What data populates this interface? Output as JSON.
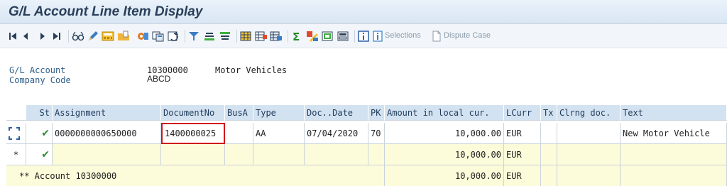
{
  "window": {
    "title": "G/L Account Line Item Display"
  },
  "toolbar": {
    "icons": [
      "first-page-icon",
      "previous-page-icon",
      "next-page-icon",
      "last-page-icon",
      "glasses-icon",
      "pencil-icon",
      "calculator-icon",
      "folder-icon",
      "settings-icon",
      "copy-icon",
      "refresh-icon",
      "filter-icon",
      "sort-ascending-icon",
      "sort-descending-icon",
      "layout-icon",
      "columns-icon",
      "subtotal-icon",
      "sum-icon",
      "edit-icon",
      "export-icon",
      "print-icon",
      "info-icon"
    ],
    "selections_label": "Selections",
    "dispute_label": "Dispute Case"
  },
  "header": {
    "gl_account_label": "G/L Account",
    "gl_account_value": "10300000",
    "gl_account_name": "Motor Vehicles",
    "company_code_label": "Company Code",
    "company_code_value": "ABCD"
  },
  "table": {
    "columns": [
      "St",
      "Assignment",
      "DocumentNo",
      "BusA",
      "Type",
      "Doc..Date",
      "PK",
      "Amount in local cur.",
      "LCurr",
      "Tx",
      "Clrng doc.",
      "Text"
    ],
    "rows": [
      {
        "st": "✔",
        "assignment": "0000000000650000",
        "document_no": "1400000025",
        "busa": "",
        "type": "AA",
        "doc_date": "07/04/2020",
        "pk": "70",
        "amount": "10,000.00",
        "lcurr": "EUR",
        "tx": "",
        "clrng_doc": "",
        "text": "New Motor Vehicle"
      }
    ],
    "subtotal": {
      "marker": "*",
      "st": "✔",
      "amount": "10,000.00",
      "lcurr": "EUR"
    },
    "total": {
      "label": "** Account 10300000",
      "amount": "10,000.00",
      "lcurr": "EUR"
    }
  }
}
